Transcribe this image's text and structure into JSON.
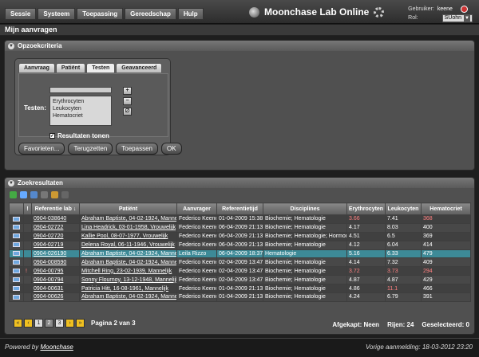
{
  "menu": [
    "Sessie",
    "Systeem",
    "Toepassing",
    "Gereedschap",
    "Hulp"
  ],
  "brand": {
    "title": "Moonchase Lab Online"
  },
  "user": {
    "label": "Gebruiker:",
    "name": "keene",
    "role_label": "Rol:",
    "role": "SUohn"
  },
  "page": {
    "title": "Mijn aanvragen"
  },
  "criteria": {
    "header": "Opzoekcriteria",
    "tabs": [
      "Aanvraag",
      "Patiënt",
      "Testen",
      "Geavanceerd"
    ],
    "active_tab": "Testen",
    "tests_label": "Testen:",
    "filter_value": "",
    "tests": [
      "Erythrocyten",
      "Leukocyten",
      "Hematocriet"
    ],
    "add_btn": "+",
    "remove_btn": "−",
    "clear_btn": "∅",
    "show_results_label": "Resultaten tonen",
    "show_results_checked": true,
    "buttons": {
      "favorites": "Favorieten...",
      "reset": "Terugzetten",
      "apply": "Toepassen",
      "ok": "OK"
    }
  },
  "results": {
    "header": "Zoekresultaten",
    "columns": [
      "",
      "!",
      "Referentie lab ↓",
      "Patiënt",
      "Aanvrager",
      "Referentietijd",
      "Disciplines",
      "Erythrocyten",
      "Leukocyten",
      "Hematocriet"
    ],
    "rows": [
      {
        "flag": "",
        "ref": "0904-038640",
        "patient": "Abraham Baptiste, 04-02-1924, Mannelijk",
        "requester": "Federico Keene",
        "time": "01-04-2009 15:38",
        "disciplines": "Biochemie; Hematologie",
        "ery": "3.66",
        "leu": "7.41",
        "hem": "368",
        "ery_red": true,
        "leu_red": false,
        "hem_red": true,
        "selected": false
      },
      {
        "flag": "",
        "ref": "0904-02722",
        "patient": "Lina Headrick, 03-01-1958, Vrouwelijk",
        "requester": "Federico Keene",
        "time": "06-04-2009 21:13",
        "disciplines": "Biochemie; Hematologie",
        "ery": "4.17",
        "leu": "8.03",
        "hem": "400",
        "ery_red": false,
        "leu_red": false,
        "hem_red": false,
        "selected": false
      },
      {
        "flag": "",
        "ref": "0904-02720",
        "patient": "Kallie Pool, 08-07-1977, Vrouwelijk",
        "requester": "Federico Keene",
        "time": "06-04-2009 21:13",
        "disciplines": "Biochemie; Hematologie; Hormonen",
        "ery": "4.51",
        "leu": "6.5",
        "hem": "369",
        "ery_red": false,
        "leu_red": false,
        "hem_red": false,
        "selected": false
      },
      {
        "flag": "",
        "ref": "0904-02719",
        "patient": "Delena Royal, 06-11-1946, Vrouwelijk",
        "requester": "Federico Keene",
        "time": "06-04-2009 21:13",
        "disciplines": "Biochemie; Hematologie",
        "ery": "4.12",
        "leu": "6.04",
        "hem": "414",
        "ery_red": false,
        "leu_red": false,
        "hem_red": false,
        "selected": false
      },
      {
        "flag": "",
        "ref": "0904-026190",
        "patient": "Abraham Baptiste, 04-02-1924, Mannelijk",
        "requester": "Leila Rizzo",
        "time": "06-04-2009 18:37",
        "disciplines": "Hematologie",
        "ery": "5.16",
        "leu": "6.33",
        "hem": "479",
        "ery_red": false,
        "leu_red": false,
        "hem_red": false,
        "selected": true
      },
      {
        "flag": "",
        "ref": "0904-008590",
        "patient": "Abraham Baptiste, 04-02-1924, Mannelijk",
        "requester": "Federico Keene",
        "time": "02-04-2009 13:47",
        "disciplines": "Biochemie; Hematologie",
        "ery": "4.14",
        "leu": "7.32",
        "hem": "409",
        "ery_red": false,
        "leu_red": false,
        "hem_red": false,
        "selected": false
      },
      {
        "flag": "!",
        "ref": "0904-00795",
        "patient": "Mitchell Ring, 23-02-1939, Mannelijk",
        "requester": "Federico Keene",
        "time": "02-04-2009 13:47",
        "disciplines": "Biochemie; Hematologie",
        "ery": "3.72",
        "leu": "3.73",
        "hem": "294",
        "ery_red": true,
        "leu_red": true,
        "hem_red": true,
        "selected": false
      },
      {
        "flag": "",
        "ref": "0904-00794",
        "patient": "Sonny Flournoy, 13-12-1948, Mannelijk",
        "requester": "Federico Keene",
        "time": "02-04-2009 13:47",
        "disciplines": "Biochemie; Hematologie",
        "ery": "4.87",
        "leu": "4.87",
        "hem": "429",
        "ery_red": false,
        "leu_red": false,
        "hem_red": false,
        "selected": false
      },
      {
        "flag": "",
        "ref": "0904-00631",
        "patient": "Patricia Hitt, 16-08-1961, Mannelijk",
        "requester": "Federico Keene",
        "time": "01-04-2009 21:13",
        "disciplines": "Biochemie; Hematologie",
        "ery": "4.86",
        "leu": "11.1",
        "hem": "466",
        "ery_red": false,
        "leu_red": true,
        "hem_red": false,
        "selected": false
      },
      {
        "flag": "",
        "ref": "0904-00626",
        "patient": "Abraham Baptiste, 04-02-1924, Mannelijk",
        "requester": "Federico Keene",
        "time": "01-04-2009 21:13",
        "disciplines": "Biochemie; Hematologie",
        "ery": "4.24",
        "leu": "6.79",
        "hem": "391",
        "ery_red": false,
        "leu_red": false,
        "hem_red": false,
        "selected": false
      }
    ],
    "pager": {
      "first": "«",
      "prev": "‹",
      "pages": [
        "1",
        "2",
        "3"
      ],
      "current": "2",
      "next": "›",
      "last": "»",
      "label": "Pagina 2 van 3"
    },
    "status": {
      "truncated": "Afgekapt: Neen",
      "rows": "Rijen: 24",
      "selected": "Geselecteerd: 0"
    }
  },
  "footer": {
    "powered_prefix": "Powered by",
    "powered_link": "Moonchase",
    "last_login": "Vorige aanmelding: 18-03-2012 23:20"
  },
  "colors": {
    "selected_row": "#3d8a97",
    "alert_value": "#ff8080",
    "pager_nav": "#f0c020"
  }
}
